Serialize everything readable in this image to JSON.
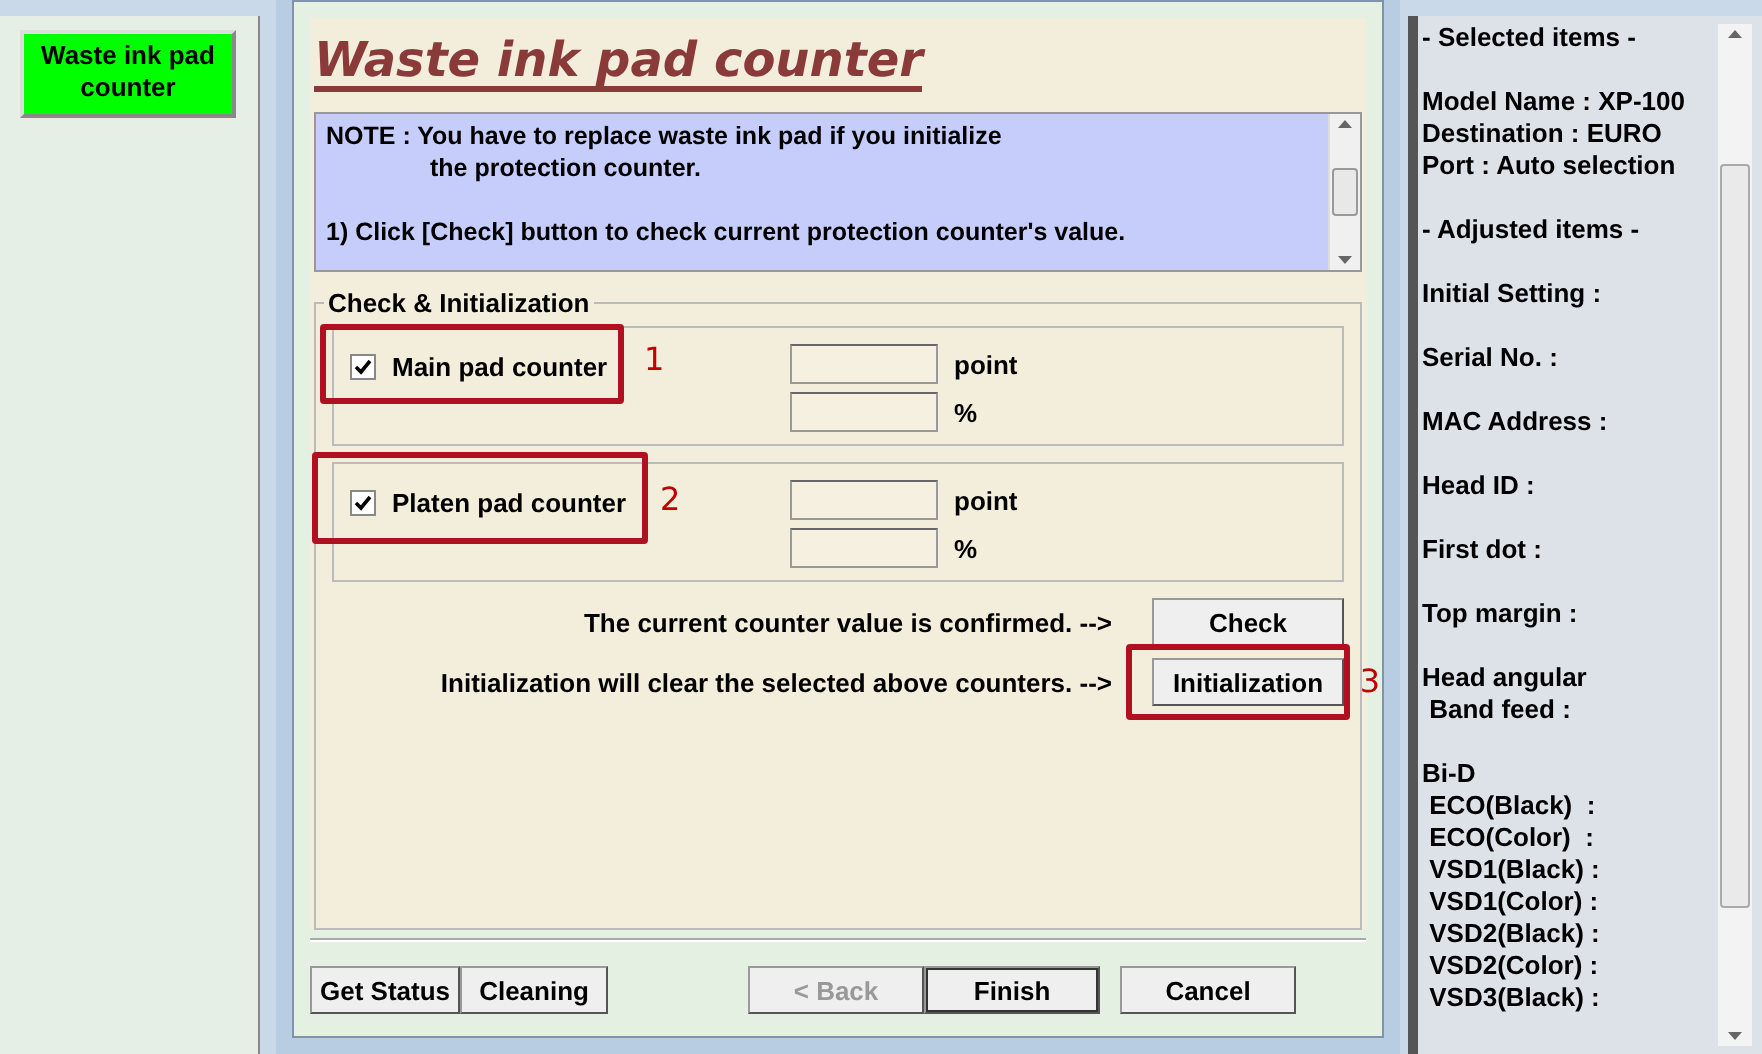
{
  "side_menu": {
    "items": [
      {
        "label": "Waste ink pad counter",
        "selected": true
      }
    ]
  },
  "dialog": {
    "title": "Waste ink pad counter",
    "note": {
      "paragraphs": [
        {
          "lines": [
            "NOTE : You have to replace waste ink pad if you initialize",
            "the protection counter."
          ]
        },
        {
          "lines": [
            "1) Click [Check] button to check current protection counter's value."
          ]
        }
      ]
    },
    "group": {
      "title": "Check & Initialization",
      "counters": [
        {
          "label": "Main pad counter",
          "checked": true,
          "unit_point": "point",
          "unit_percent": "%",
          "annotation": "1"
        },
        {
          "label": "Platen pad counter",
          "checked": true,
          "unit_point": "point",
          "unit_percent": "%",
          "annotation": "2"
        }
      ],
      "actions": [
        {
          "text": "The current counter value is confirmed. -->",
          "button": "Check",
          "highlighted": false
        },
        {
          "text": "Initialization will clear the selected above counters. -->",
          "button": "Initialization",
          "highlighted": true,
          "annotation": "3"
        }
      ]
    },
    "tool_buttons": [
      {
        "label": "Get Status",
        "disabled": false
      },
      {
        "label": "Cleaning",
        "disabled": false
      }
    ],
    "nav_buttons": [
      {
        "label": "< Back",
        "disabled": true,
        "default": false
      },
      {
        "label": "Finish",
        "disabled": false,
        "default": true
      },
      {
        "label": "Cancel",
        "disabled": false,
        "default": false
      }
    ]
  },
  "info_panel": {
    "sections": [
      {
        "lines": [
          "- Selected items -"
        ]
      },
      {
        "lines": [
          "Model Name : XP-100",
          "Destination : EURO",
          "Port : Auto selection"
        ]
      },
      {
        "lines": [
          "- Adjusted items -"
        ]
      },
      {
        "lines": [
          "Initial Setting :"
        ]
      },
      {
        "lines": [
          "Serial No. :"
        ]
      },
      {
        "lines": [
          "MAC Address :"
        ]
      },
      {
        "lines": [
          "Head ID :"
        ]
      },
      {
        "lines": [
          "First dot :"
        ]
      },
      {
        "lines": [
          "Top margin :"
        ]
      },
      {
        "lines": [
          "Head angular",
          " Band feed :"
        ]
      },
      {
        "lines": [
          "Bi-D",
          " ECO(Black)  :",
          " ECO(Color)  :",
          " VSD1(Black) :",
          " VSD1(Color) :",
          " VSD2(Black) :",
          " VSD2(Color) :",
          " VSD3(Black) :"
        ]
      }
    ]
  }
}
